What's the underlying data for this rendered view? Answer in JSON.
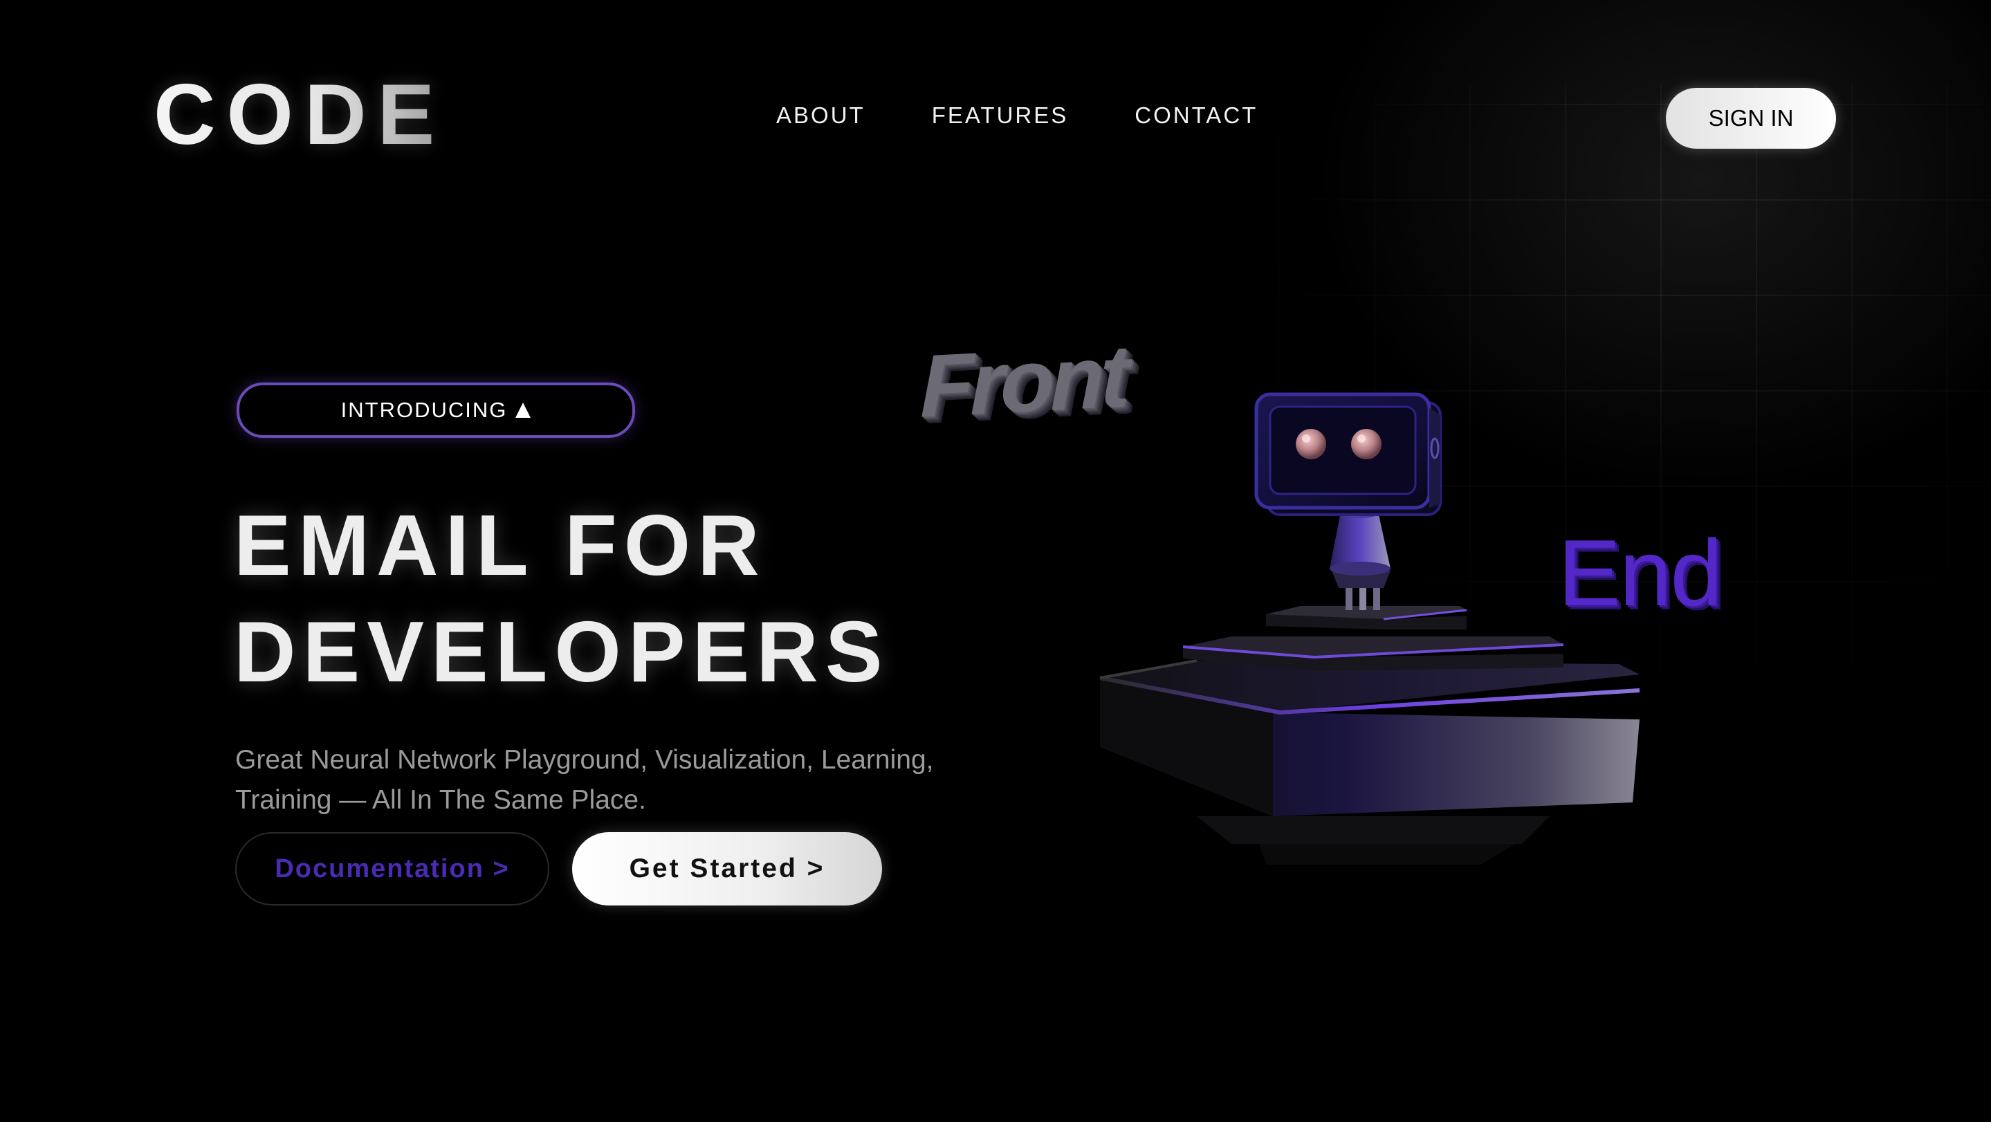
{
  "header": {
    "logo": "CODE",
    "nav": [
      {
        "label": "ABOUT"
      },
      {
        "label": "FEATURES"
      },
      {
        "label": "CONTACT"
      }
    ],
    "sign_in_label": "SIGN IN"
  },
  "hero": {
    "badge_label": "INTRODUCING",
    "badge_icon": "triangle-up-icon",
    "headline_line1": "EMAIL FOR",
    "headline_line2": "DEVELOPERS",
    "subtitle_line1": "Great Neural Network Playground, Visualization, Learning,",
    "subtitle_line2": "Training — All In The Same Place.",
    "docs_button_label": "Documentation >",
    "get_started_label": "Get Started >"
  },
  "illustration": {
    "front_text": "Front",
    "end_text": "End",
    "robot": "robot-on-pedestal-illustration"
  },
  "colors": {
    "background": "#000000",
    "accent_purple": "#5428c8",
    "docs_text": "#4b2bb3",
    "badge_border": "#6a4bb8"
  }
}
